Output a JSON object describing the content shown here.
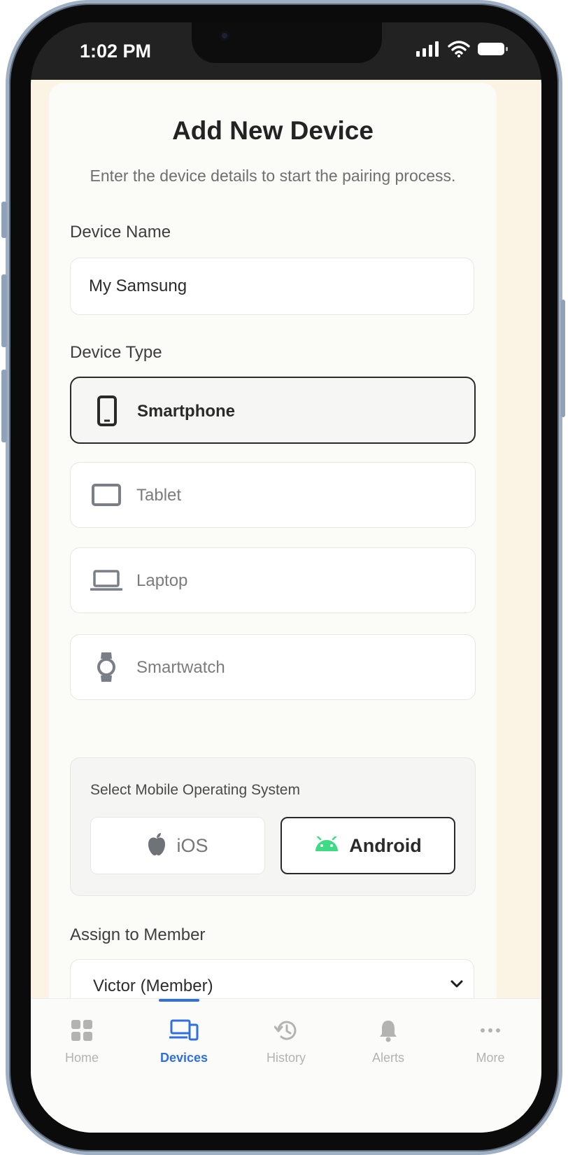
{
  "status_bar": {
    "time": "1:02 PM"
  },
  "form": {
    "title": "Add New Device",
    "subtitle": "Enter the device details to start the pairing process.",
    "device_name": {
      "label": "Device Name",
      "value": "My Samsung"
    },
    "device_type": {
      "label": "Device Type",
      "options": [
        {
          "label": "Smartphone",
          "icon": "smartphone-icon",
          "selected": true
        },
        {
          "label": "Tablet",
          "icon": "tablet-icon",
          "selected": false
        },
        {
          "label": "Laptop",
          "icon": "laptop-icon",
          "selected": false
        },
        {
          "label": "Smartwatch",
          "icon": "smartwatch-icon",
          "selected": false
        }
      ]
    },
    "os": {
      "title": "Select Mobile Operating System",
      "options": [
        {
          "label": "iOS",
          "icon": "apple-icon",
          "selected": false
        },
        {
          "label": "Android",
          "icon": "android-icon",
          "selected": true
        }
      ]
    },
    "assign": {
      "label": "Assign to Member",
      "selected": "Victor (Member)"
    }
  },
  "nav": {
    "items": [
      {
        "label": "Home",
        "icon": "grid-icon",
        "active": false
      },
      {
        "label": "Devices",
        "icon": "devices-icon",
        "active": true
      },
      {
        "label": "History",
        "icon": "history-icon",
        "active": false
      },
      {
        "label": "Alerts",
        "icon": "bell-icon",
        "active": false
      },
      {
        "label": "More",
        "icon": "more-icon",
        "active": false
      }
    ]
  },
  "colors": {
    "accent": "#2f6fe0",
    "android_green": "#3ddc84",
    "app_background": "#fbf4e4"
  }
}
